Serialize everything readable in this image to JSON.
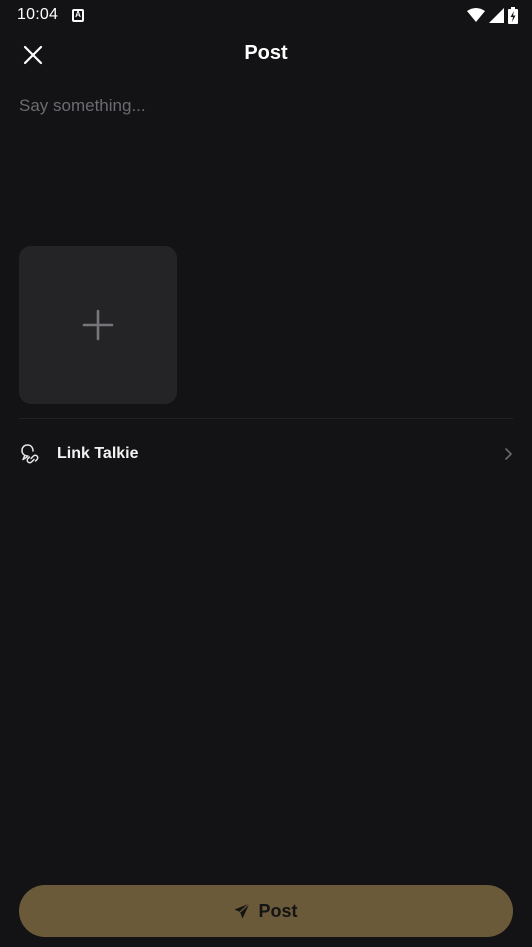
{
  "status_bar": {
    "time": "10:04",
    "app_icon_letter": "A",
    "icons": [
      "wifi-icon",
      "signal-icon",
      "battery-charging-icon"
    ]
  },
  "header": {
    "title": "Post",
    "close_icon": "close-icon"
  },
  "composer": {
    "placeholder": "Say something...",
    "value": ""
  },
  "media": {
    "add_icon": "plus-icon"
  },
  "link_row": {
    "label": "Link Talkie",
    "icon": "link-talkie-icon",
    "chevron": "chevron-right-icon"
  },
  "post_button": {
    "label": "Post",
    "icon": "send-icon"
  },
  "colors": {
    "background": "#131315",
    "tile": "#242426",
    "accent": "#6b5a3a",
    "placeholder": "#6b6b70"
  }
}
